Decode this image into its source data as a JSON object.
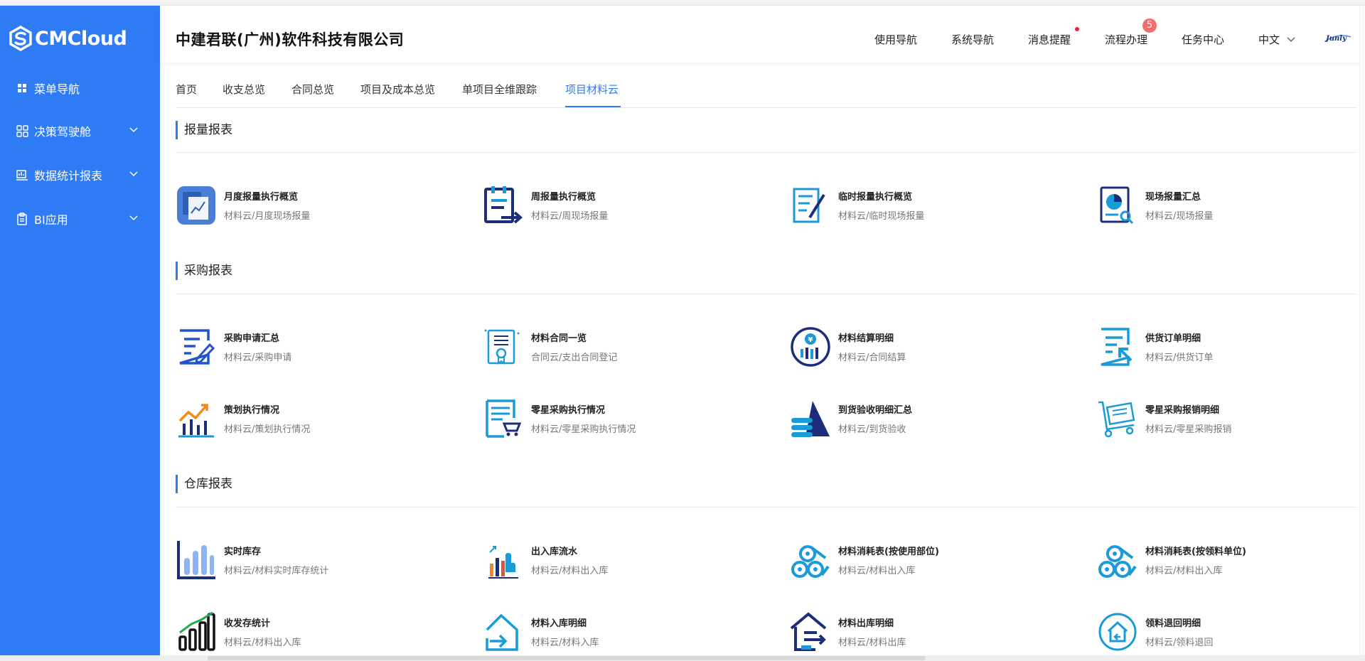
{
  "brand": {
    "name": "CMCloud"
  },
  "sidebar": {
    "items": [
      {
        "label": "菜单导航",
        "icon": "grid-icon"
      },
      {
        "label": "决策驾驶舱",
        "icon": "apps-icon"
      },
      {
        "label": "数据统计报表",
        "icon": "report-icon"
      },
      {
        "label": "BI应用",
        "icon": "clipboard-icon"
      }
    ]
  },
  "header": {
    "company": "中建君联(广州)软件科技有限公司",
    "nav": [
      "使用导航",
      "系统导航",
      "消息提醒",
      "流程办理",
      "任务中心"
    ],
    "process_badge": "5",
    "language": "中文",
    "mini_brand": "Junly"
  },
  "tabs": [
    "首页",
    "收支总览",
    "合同总览",
    "项目及成本总览",
    "单项目全维跟踪",
    "项目材料云"
  ],
  "sections": [
    {
      "title": "报量报表",
      "cards": [
        {
          "title": "月度报量执行概览",
          "sub": "材料云/月度现场报量",
          "icon": "monthly-chart-icon"
        },
        {
          "title": "周报量执行概览",
          "sub": "材料云/周现场报量",
          "icon": "weekly-doc-icon"
        },
        {
          "title": "临时报量执行概览",
          "sub": "材料云/临时现场报量",
          "icon": "edit-doc-icon"
        },
        {
          "title": "现场报量汇总",
          "sub": "材料云/现场报量",
          "icon": "pie-search-icon"
        }
      ]
    },
    {
      "title": "采购报表",
      "cards": [
        {
          "title": "采购申请汇总",
          "sub": "材料云/采购申请",
          "icon": "request-edit-icon"
        },
        {
          "title": "材料合同一览",
          "sub": "合同云/支出合同登记",
          "icon": "contract-icon"
        },
        {
          "title": "材料结算明细",
          "sub": "材料云/合同结算",
          "icon": "yuan-chart-icon"
        },
        {
          "title": "供货订单明细",
          "sub": "材料云/供货订单",
          "icon": "order-icon"
        },
        {
          "title": "策划执行情况",
          "sub": "材料云/策划执行情况",
          "icon": "trend-chart-icon"
        },
        {
          "title": "零星采购执行情况",
          "sub": "材料云/零星采购执行情况",
          "icon": "cart-doc-icon"
        },
        {
          "title": "到货验收明细汇总",
          "sub": "材料云/到货验收",
          "icon": "stack-triangle-icon"
        },
        {
          "title": "零星采购报销明细",
          "sub": "材料云/零星采购报销",
          "icon": "trolley-icon"
        }
      ]
    },
    {
      "title": "仓库报表",
      "cards": [
        {
          "title": "实时库存",
          "sub": "材料云/材料实时库存统计",
          "icon": "bar-chart-icon"
        },
        {
          "title": "出入库流水",
          "sub": "材料云/材料出入库",
          "icon": "hand-chart-icon"
        },
        {
          "title": "材料消耗表(按使用部位)",
          "sub": "材料云/材料出入库",
          "icon": "pipes-icon"
        },
        {
          "title": "材料消耗表(按领料单位)",
          "sub": "材料云/材料出入库",
          "icon": "pipes-icon"
        },
        {
          "title": "收发存统计",
          "sub": "材料云/材料出入库",
          "icon": "growth-bars-icon"
        },
        {
          "title": "材料入库明细",
          "sub": "材料云/材料入库",
          "icon": "house-in-icon"
        },
        {
          "title": "材料出库明细",
          "sub": "材料云/材料出库",
          "icon": "house-out-icon"
        },
        {
          "title": "领料退回明细",
          "sub": "材料云/领料退回",
          "icon": "house-return-icon"
        }
      ]
    }
  ],
  "colors": {
    "primary": "#2f7bf5",
    "navy": "#1c2d7a",
    "cyan": "#1a9ad6",
    "badge": "#f56c6c"
  }
}
